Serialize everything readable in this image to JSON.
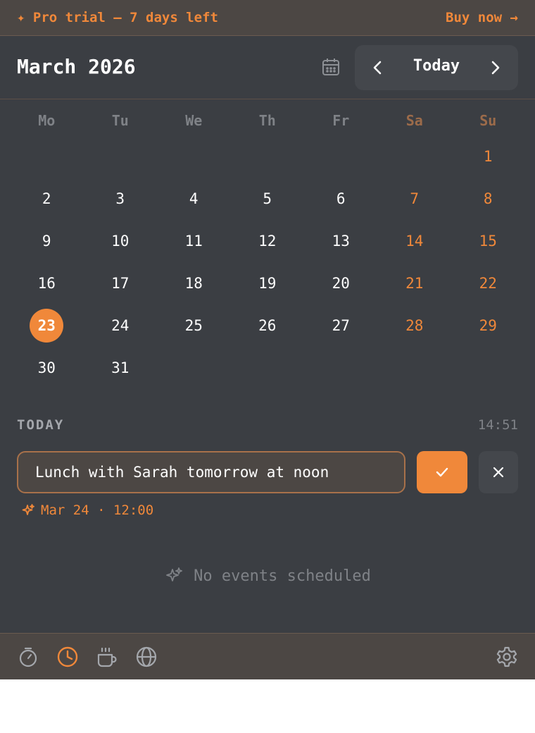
{
  "banner": {
    "text": "✦ Pro trial — 7 days left",
    "link": "Buy now →"
  },
  "header": {
    "month_title": "March 2026",
    "today_button": "Today"
  },
  "weekdays": [
    "Mo",
    "Tu",
    "We",
    "Th",
    "Fr",
    "Sa",
    "Su"
  ],
  "calendar": {
    "leading_blanks": 6,
    "days": [
      "1",
      "2",
      "3",
      "4",
      "5",
      "6",
      "7",
      "8",
      "9",
      "10",
      "11",
      "12",
      "13",
      "14",
      "15",
      "16",
      "17",
      "18",
      "19",
      "20",
      "21",
      "22",
      "23",
      "24",
      "25",
      "26",
      "27",
      "28",
      "29",
      "30",
      "31"
    ],
    "selected_day": "23"
  },
  "today_section": {
    "label": "TODAY",
    "time": "14:51"
  },
  "quick_add": {
    "value": "Lunch with Sarah tomorrow at noon",
    "parsed": "Mar 24 · 12:00"
  },
  "empty_state": {
    "text": "No events scheduled"
  },
  "footer": {
    "icons": [
      "stopwatch-icon",
      "clock-icon",
      "coffee-icon",
      "globe-icon",
      "settings-icon"
    ],
    "active": "clock-icon"
  },
  "colors": {
    "accent": "#f0883a",
    "background": "#3b3e43",
    "banner_bg": "#4c4744",
    "muted": "#7f8287"
  }
}
